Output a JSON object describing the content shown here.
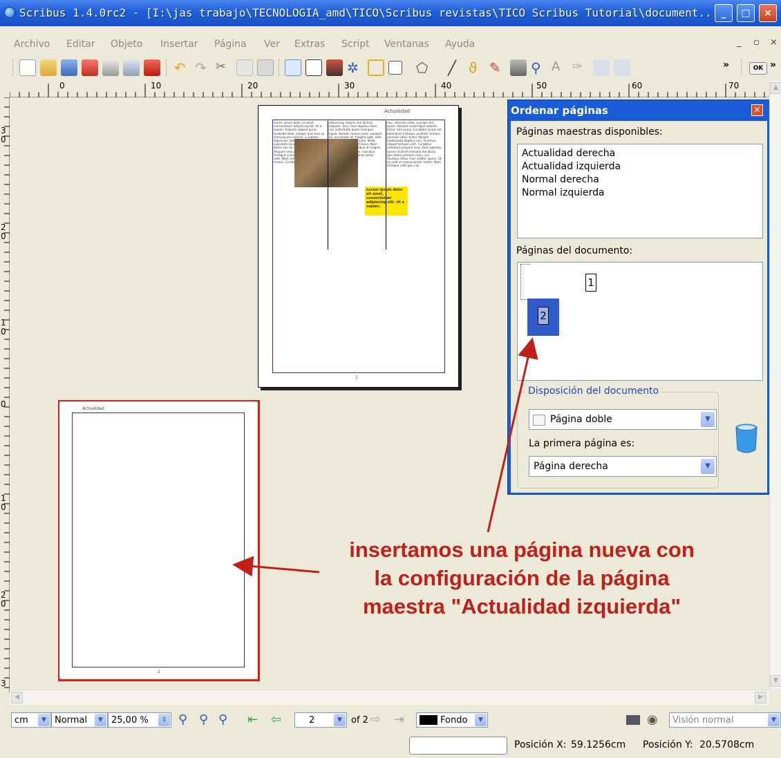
{
  "window": {
    "title": "Scribus 1.4.0rc2 - [I:\\jas trabajo\\TECNOLOGIA_amd\\TICO\\Scribus revistas\\TICO Scribus Tutorial\\document...",
    "minimize": "_",
    "maximize": "□",
    "close": "×"
  },
  "menu": [
    "Archivo",
    "Editar",
    "Objeto",
    "Insertar",
    "Página",
    "Ver",
    "Extras",
    "Script",
    "Ventanas",
    "Ayuda"
  ],
  "menu_right": {
    "minimize": "_",
    "restore": "▫",
    "close": "×"
  },
  "toolbar": {
    "icons": [
      "new-document-icon",
      "open-icon",
      "save-icon",
      "close-document-icon",
      "print-icon",
      "preflight-icon",
      "export-pdf-icon",
      "undo-icon",
      "redo-icon",
      "cut-icon",
      "copy-icon",
      "paste-icon",
      "select-icon",
      "text-frame-icon",
      "image-frame-icon",
      "render-frame-icon",
      "table-icon",
      "shape-icon",
      "polygon-icon",
      "line-icon",
      "bezier-icon",
      "freehand-icon",
      "rotate-icon",
      "zoom-icon",
      "edit-text-icon",
      "link-frames-icon",
      "unlink-frames-icon",
      "measure-icon",
      "more-icon"
    ],
    "ok_label": "OK"
  },
  "ruler": {
    "h_labels": [
      "0",
      "10",
      "20",
      "30",
      "40",
      "50",
      "60",
      "70"
    ],
    "v_labels": [
      "3\n0",
      "2\n0",
      "1\n0",
      "0",
      "1\n0",
      "2\n0",
      "3"
    ]
  },
  "page1": {
    "header": "Actualidad",
    "col1": "Lorem ipsum dolor sit amet, consectetuer adipiscing elit. Ut a sapien. Aliquam aliquet purus molestie dolor. Integer quis eros ut erat posuere dictum. Curabitur dignissim. Integer orci. Fusce vulputate lacus at ipsum. Quisque in libero nec mi laoreet volutpat. Aliquam eros pede, scelerisque quis, tristique cursus, placerat convallis, velit. Nam condimentum. Nulla ut mauris. Curabitur",
    "col2": "adipiscing, mauris non dictum aliquam, arcu risus dapibus diam, nec sollicitudin quam erat quis ligula. Aenean massa nulla, volutpat eu, accumsan et, fringilla eget, odio. Nulla placerat porta justo. Nulla vitae turpis. Praesent lacus. Nam sociis natoque penatibus et magnis dis parturient montes, nascetur ridiculus mus. Maecenas tortor metus, pellentesque",
    "col3": "nec, vehicula vitae, suscipit sed, quam. Aenean scelerisque sodales tortor. Sed purus. Curabitur turpis est, bibendum tristique, porttitor tempor, pulvinar vitae, tortor. Nullam malesuada dapibus orci. Vivamus aliquet tempus velit. Curabitur interdum posuere risus. Duis egestas, ipsum id amet molestie tincidunt, quis libero pretium risus, non faucibus tellus risus mattis sapien. Ut eu velit et massa auctor mattis. Nam tristique velit quis nisl.",
    "highlight": "Lorem ipsum dolor sit amet, consectetuer adipiscing elit. Ut a sapien.",
    "page_number": "1"
  },
  "page2": {
    "header": "Actualidad",
    "page_number": "2"
  },
  "dialog": {
    "title": "Ordenar páginas",
    "masters_label": "Páginas maestras disponibles:",
    "masters": [
      "Actualidad derecha",
      "Actualidad izquierda",
      "Normal derecha",
      "Normal izquierda"
    ],
    "doc_pages_label": "Páginas del documento:",
    "doc_pages": [
      "1",
      "2"
    ],
    "layout_group": "Disposición del documento",
    "layout_value": "Página doble",
    "first_page_label": "La primera página es:",
    "first_page_value": "Página derecha"
  },
  "annotation": {
    "line1": "insertamos una página nueva con",
    "line2": "la configuración de la página",
    "line3": "maestra \"Actualidad izquierda\""
  },
  "bottombar": {
    "unit": "cm",
    "mode": "Normal",
    "zoom": "25,00 %",
    "page": "2",
    "page_total": "of 2",
    "layer": "Fondo",
    "view": "Visión normal"
  },
  "status": {
    "pos_x_label": "Posición X:",
    "pos_x": "59.1256cm",
    "pos_y_label": "Posición Y:",
    "pos_y": "20.5708cm"
  },
  "colors": {
    "titlebar": "#1f5fd8",
    "annotation": "#c0201a",
    "highlight": "#ffe600",
    "selection": "#2f5cc8"
  }
}
